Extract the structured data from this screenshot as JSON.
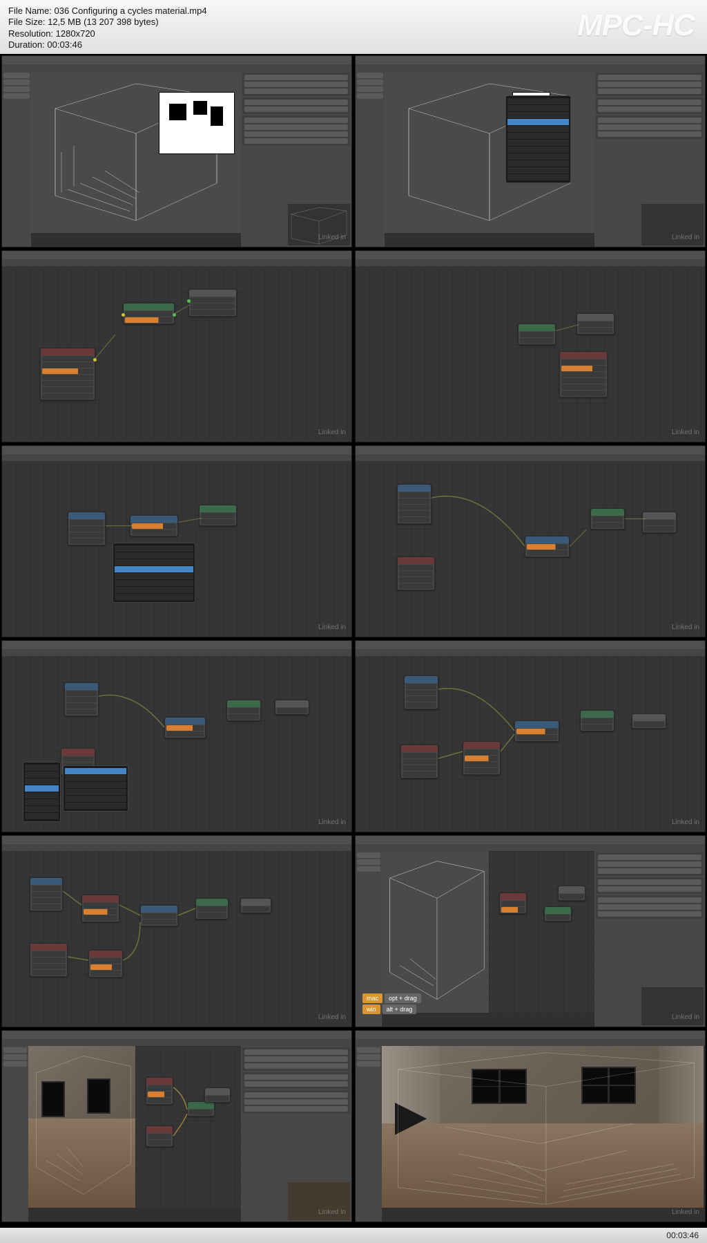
{
  "header": {
    "file_name_label": "File Name:",
    "file_name": "036 Configuring a cycles material.mp4",
    "file_size_label": "File Size:",
    "file_size": "12,5 MB (13 207 398 bytes)",
    "resolution_label": "Resolution:",
    "resolution": "1280x720",
    "duration_label": "Duration:",
    "duration": "00:03:46"
  },
  "app_logo": "MPC-HC",
  "watermark": "Linked in",
  "footer": {
    "time": "00:03:46"
  },
  "shortcuts": {
    "mac_os": "mac",
    "mac_key": "opt + drag",
    "win_os": "win",
    "win_key": "alt + drag"
  },
  "thumbs": [
    {
      "id": 1,
      "desc": "Blender 3D viewport wireframe room with render preview, properties panel"
    },
    {
      "id": 2,
      "desc": "Same viewport with editor type dropdown menu open"
    },
    {
      "id": 3,
      "desc": "Node editor: Image Texture → Diffuse BSDF → Material Output"
    },
    {
      "id": 4,
      "desc": "Node editor: Image Texture, Diffuse, Mapping, Texture Coordinate nodes"
    },
    {
      "id": 5,
      "desc": "Node editor with image browser dropdown open"
    },
    {
      "id": 6,
      "desc": "Node editor: Tex Coord → Mapping → Image Texture → Diffuse → Output chain"
    },
    {
      "id": 7,
      "desc": "Node editor with Add menu open showing node categories"
    },
    {
      "id": 8,
      "desc": "Node editor: two Image Texture nodes into Mix → Diffuse → Output"
    },
    {
      "id": 9,
      "desc": "Node editor: Tex Coord, two textures, Mix, Bump, Diffuse setup"
    },
    {
      "id": 10,
      "desc": "Split view: 3D viewport + node editor + properties, shortcut overlay"
    },
    {
      "id": 11,
      "desc": "Split view: 3D viewport + node editor with textured floor material"
    },
    {
      "id": 12,
      "desc": "Large rendered viewport: textured room interior with windows"
    }
  ]
}
